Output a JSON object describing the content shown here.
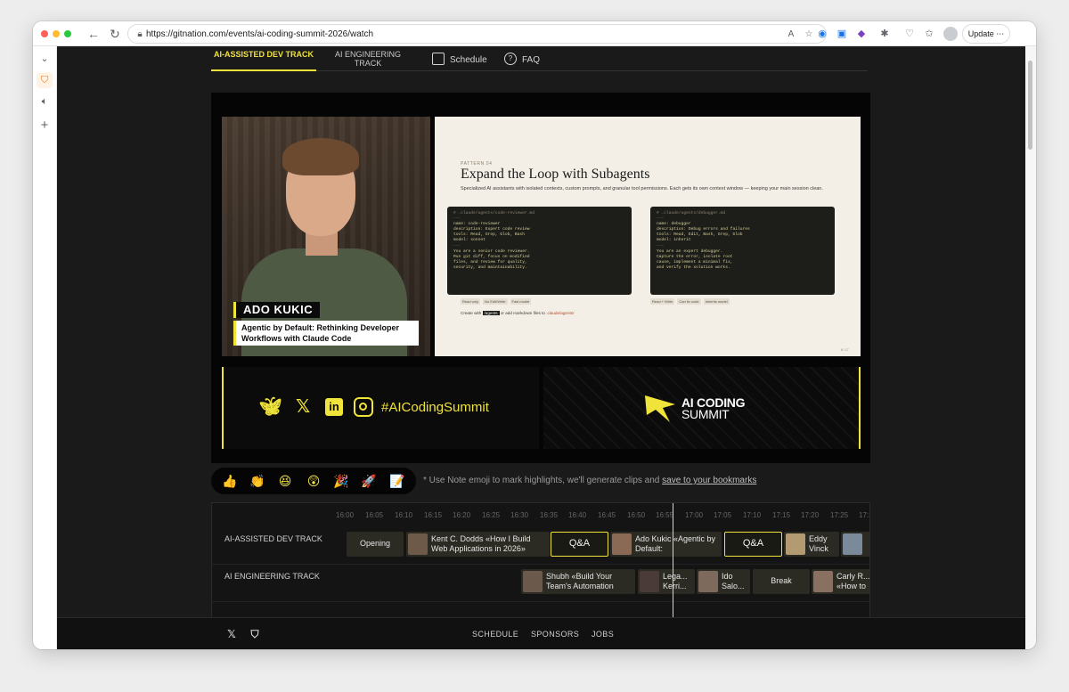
{
  "browser": {
    "url": "https://gitnation.com/events/ai-coding-summit-2026/watch",
    "update_label": "Update",
    "update_menu": "⋯"
  },
  "tabs": {
    "ai_assisted": "AI-ASSISTED DEV TRACK",
    "ai_engineering": "AI ENGINEERING TRACK",
    "schedule": "Schedule",
    "faq": "FAQ"
  },
  "video": {
    "speaker_name": "ADO KUKIC",
    "talk_title": "Agentic by Default: Rethinking Developer Workflows with Claude Code",
    "slide": {
      "pattern_label": "PATTERN 04",
      "title": "Expand the Loop with Subagents",
      "description": "Specialized AI assistants with isolated contexts, custom prompts, and granular tool permissions. Each gets its own context window — keeping your main session clean.",
      "card_left": {
        "lines": [
          "# .claude/agents/code-reviewer.md",
          "---",
          "name: code-reviewer",
          "description: Expert code review",
          "tools: Read, Grep, Glob, Bash",
          "model: sonnet",
          "---",
          "",
          "You are a senior code reviewer.",
          "Run git diff, focus on modified",
          "files, and review for quality,",
          "security, and maintainability."
        ],
        "pills": [
          "Read only",
          "No Edit/Write",
          "Fast model"
        ]
      },
      "card_right": {
        "lines": [
          "# .claude/agents/debugger.md",
          "---",
          "name: debugger",
          "description: Debug errors and failures",
          "tools: Read, Edit, Bash, Grep, Glob",
          "model: inherit",
          "---",
          "",
          "You are an expert debugger.",
          "Capture the error, isolate root",
          "cause, implement a minimal fix,",
          "and verify the solution works."
        ],
        "pills": [
          "Read + Write",
          "Can fix code",
          "Inherits model"
        ]
      },
      "create_prefix": "Create with",
      "create_cmd": "/agents",
      "create_mid": "or add markdown files to",
      "create_path": ".claude/agents/",
      "page": "6 / 17"
    },
    "hashtag": "#AICodingSummit",
    "brand_line1": "AI CODING",
    "brand_line2": "SUMMIT"
  },
  "reactions": [
    "👍",
    "👏",
    "😆",
    "😲",
    "🎉",
    "🚀",
    "📝"
  ],
  "hint": {
    "text": "* Use Note emoji to mark highlights, we'll generate clips and",
    "link": "save to your bookmarks"
  },
  "timeline": {
    "times": [
      "16:00",
      "16:05",
      "16:10",
      "16:15",
      "16:20",
      "16:25",
      "16:30",
      "16:35",
      "16:40",
      "16:45",
      "16:50",
      "16:55",
      "17:00",
      "17:05",
      "17:10",
      "17:15",
      "17:20",
      "17:25",
      "17:3"
    ],
    "tracks": [
      {
        "label": "AI-ASSISTED DEV TRACK",
        "sessions": [
          {
            "title": "Opening"
          },
          {
            "title": "Kent C. Dodds «How I Build Web Applications in 2026»"
          },
          {
            "title": "Q&A"
          },
          {
            "title": "Ado Kukic «Agentic by Default:"
          },
          {
            "title": "Q&A"
          },
          {
            "title": "Eddy Vinck"
          },
          {
            "title": ""
          }
        ]
      },
      {
        "label": "AI ENGINEERING TRACK",
        "sessions": [
          {
            "title": ""
          },
          {
            "title": "Shubh «Build Your Team's Automation"
          },
          {
            "title": "Lega... Kerri..."
          },
          {
            "title": "Ido Salo..."
          },
          {
            "title": "Break"
          },
          {
            "title": "Carly R... «How to"
          }
        ]
      }
    ]
  },
  "footer": {
    "links": [
      "SCHEDULE",
      "SPONSORS",
      "JOBS"
    ]
  },
  "colors": {
    "accent": "#f0e33a",
    "page_bg": "#1a1a1a"
  }
}
